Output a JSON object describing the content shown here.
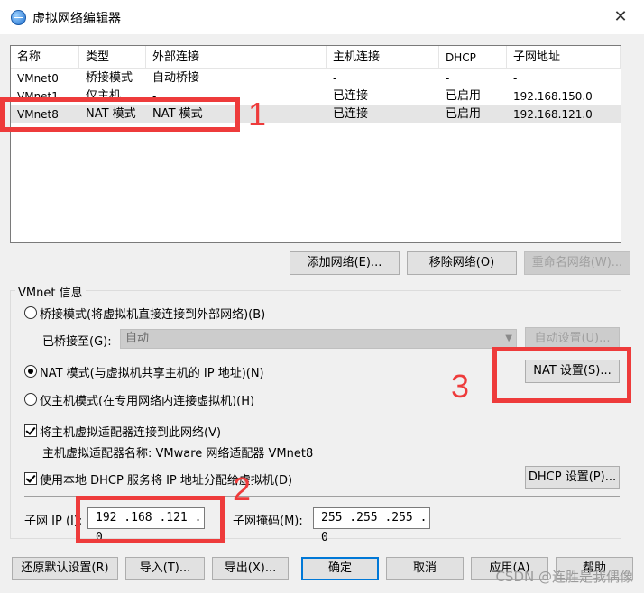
{
  "window": {
    "title": "虚拟网络编辑器",
    "close_glyph": "✕"
  },
  "list": {
    "headers": [
      "名称",
      "类型",
      "外部连接",
      "主机连接",
      "DHCP",
      "子网地址"
    ],
    "rows": [
      [
        "VMnet0",
        "桥接模式",
        "自动桥接",
        "-",
        "-",
        "-"
      ],
      [
        "VMnet1",
        "仅主机...",
        "-",
        "已连接",
        "已启用",
        "192.168.150.0"
      ],
      [
        "VMnet8",
        "NAT 模式",
        "NAT 模式",
        "已连接",
        "已启用",
        "192.168.121.0"
      ]
    ],
    "selected_row": 2
  },
  "list_buttons": {
    "add": "添加网络(E)...",
    "remove": "移除网络(O)",
    "rename": "重命名网络(W)..."
  },
  "vmnet_info": {
    "group_label": "VMnet 信息",
    "bridge_label": "桥接模式(将虚拟机直接连接到外部网络)(B)",
    "bridged_to_label": "已桥接至(G):",
    "bridged_to_value": "自动",
    "auto_settings": "自动设置(U)...",
    "nat_label": "NAT 模式(与虚拟机共享主机的 IP 地址)(N)",
    "nat_settings": "NAT 设置(S)...",
    "hostonly_label": "仅主机模式(在专用网络内连接虚拟机)(H)",
    "connect_adapter_label": "将主机虚拟适配器连接到此网络(V)",
    "adapter_name_label": "主机虚拟适配器名称: VMware 网络适配器 VMnet8",
    "dhcp_label": "使用本地 DHCP 服务将 IP 地址分配给虚拟机(D)",
    "dhcp_settings": "DHCP 设置(P)...",
    "subnet_ip_label": "子网 IP (I):",
    "subnet_ip_value": "192 .168 .121 .  0",
    "subnet_mask_label": "子网掩码(M):",
    "subnet_mask_value": "255 .255 .255 .  0",
    "mode_selected": "nat"
  },
  "footer": {
    "restore": "还原默认设置(R)",
    "import": "导入(T)...",
    "export": "导出(X)...",
    "ok": "确定",
    "cancel": "取消",
    "apply": "应用(A)",
    "help": "帮助"
  },
  "annotations": {
    "n1": "1",
    "n2": "2",
    "n3": "3",
    "color": "#ee3b3b"
  },
  "watermark": "CSDN @连胜是我偶像"
}
